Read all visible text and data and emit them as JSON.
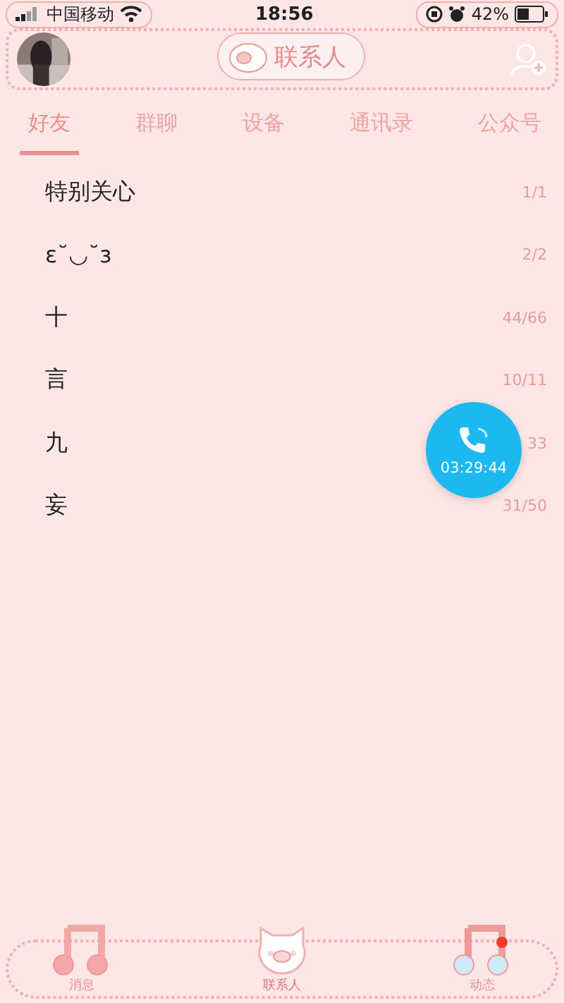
{
  "status_bar": {
    "carrier": "中国移动",
    "time": "18:56",
    "battery": "42%"
  },
  "header": {
    "title": "联系人"
  },
  "tabs": [
    {
      "label": "好友",
      "selected": true
    },
    {
      "label": "群聊",
      "selected": false
    },
    {
      "label": "设备",
      "selected": false
    },
    {
      "label": "通讯录",
      "selected": false
    },
    {
      "label": "公众号",
      "selected": false
    }
  ],
  "groups": [
    {
      "name": "特别关心",
      "count": "1/1"
    },
    {
      "name": "ε˘◡˘з",
      "count": "2/2"
    },
    {
      "name": "十",
      "count": "44/66"
    },
    {
      "name": "言",
      "count": "10/11"
    },
    {
      "name": "九",
      "count": "33"
    },
    {
      "name": "妄",
      "count": "31/50"
    }
  ],
  "call": {
    "duration": "03:29:44"
  },
  "nav": [
    {
      "label": "消息",
      "selected": false,
      "badge": false
    },
    {
      "label": "联系人",
      "selected": true,
      "badge": false
    },
    {
      "label": "动态",
      "selected": false,
      "badge": true
    }
  ]
}
